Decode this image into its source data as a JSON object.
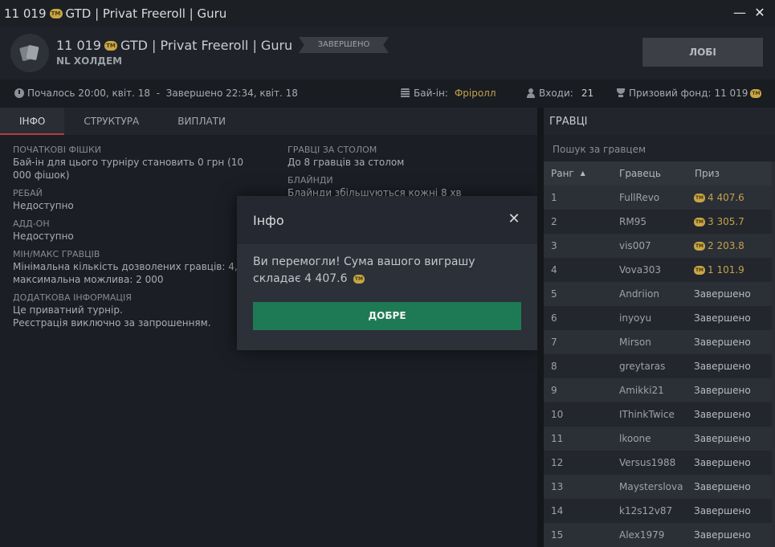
{
  "window": {
    "title_prefix": "11 019",
    "title_suffix": "GTD | Privat Freeroll | Guru",
    "coin_label": "TM",
    "minimize": "—",
    "close": "✕"
  },
  "header": {
    "title_prefix": "11 019",
    "title_suffix": "GTD | Privat Freeroll | Guru",
    "game_type": "NL ХОЛДЕМ",
    "status_badge": "ЗАВЕРШЕНО",
    "lobby_button": "ЛОБІ"
  },
  "infobar": {
    "schedule": "Почалось 20:00, квіт. 18  -  Завершено 22:34, квіт. 18",
    "buyin_label": "Бай-ін:",
    "buyin_value": "Фріролл",
    "entries_label": "Входи:",
    "entries_value": "21",
    "prize_label": "Призовий фонд:",
    "prize_value": "11 019"
  },
  "tabs": [
    {
      "label": "ІНФО"
    },
    {
      "label": "СТРУКТУРА"
    },
    {
      "label": "ВИПЛАТИ"
    }
  ],
  "info": {
    "left": [
      {
        "title": "ПОЧАТКОВІ ФІШКИ",
        "value": "Бай-ін для цього турніру становить 0 грн (10 000 фішок)"
      },
      {
        "title": "РЕБАЙ",
        "value": "Недоступно"
      },
      {
        "title": "АДД-ОН",
        "value": "Недоступно"
      },
      {
        "title": "МІН/МАКС ГРАВЦІВ",
        "value": "Мінімальна кількість дозволених гравців: 4, максимальна можлива: 2 000"
      },
      {
        "title": "ДОДАТКОВА ІНФОРМАЦІЯ",
        "value": "Це приватний турнір.",
        "value2": "Реєстрація виключно за запрошенням."
      }
    ],
    "right": [
      {
        "title": "ГРАВЦІ ЗА СТОЛОМ",
        "value": "До 8 гравців за столом"
      },
      {
        "title": "БЛАЙНДИ",
        "value": "Блайнди збільшуються кожні 8 хв"
      }
    ]
  },
  "modal": {
    "title": "Інфо",
    "close": "✕",
    "message": "Ви перемогли! Сума вашого виграшу складає 4 407.6",
    "ok_button": "ДОБРЕ"
  },
  "players": {
    "title": "ГРАВЦІ",
    "search_placeholder": "Пошук за гравцем",
    "col_rank": "Ранг",
    "sort_arrow": "▲",
    "col_player": "Гравець",
    "col_prize": "Приз",
    "rows": [
      {
        "rank": "1",
        "name": "FullRevo",
        "prize": "4 407.6"
      },
      {
        "rank": "2",
        "name": "RM95",
        "prize": "3 305.7"
      },
      {
        "rank": "3",
        "name": "vis007",
        "prize": "2 203.8"
      },
      {
        "rank": "4",
        "name": "Vova303",
        "prize": "1 101.9"
      },
      {
        "rank": "5",
        "name": "Andriion",
        "prize": "Завершено"
      },
      {
        "rank": "6",
        "name": "inyoyu",
        "prize": "Завершено"
      },
      {
        "rank": "7",
        "name": "Mirson",
        "prize": "Завершено"
      },
      {
        "rank": "8",
        "name": "greytaras",
        "prize": "Завершено"
      },
      {
        "rank": "9",
        "name": "Amikki21",
        "prize": "Завершено"
      },
      {
        "rank": "10",
        "name": "IThinkTwice",
        "prize": "Завершено"
      },
      {
        "rank": "11",
        "name": "lkoone",
        "prize": "Завершено"
      },
      {
        "rank": "12",
        "name": "Versus1988",
        "prize": "Завершено"
      },
      {
        "rank": "13",
        "name": "Maysterslova",
        "prize": "Завершено"
      },
      {
        "rank": "14",
        "name": "k12s12v87",
        "prize": "Завершено"
      },
      {
        "rank": "15",
        "name": "Alex1979",
        "prize": "Завершено"
      }
    ]
  },
  "colors": {
    "accent_green": "#1e7a55",
    "gold": "#c3a24b",
    "tab_underline": "#b53b3b"
  }
}
